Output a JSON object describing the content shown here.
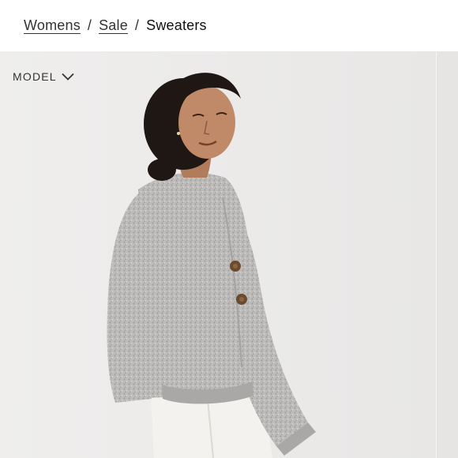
{
  "breadcrumb": {
    "items": [
      {
        "label": "Womens",
        "link": true
      },
      {
        "label": "Sale",
        "link": true
      },
      {
        "label": "Sweaters",
        "link": false
      }
    ],
    "separator": "/"
  },
  "gallery": {
    "model_toggle_label": "MODEL",
    "model_toggle_icon": "chevron-down-icon",
    "photo_subject": "model wearing grey button cardigan sweater"
  },
  "colors": {
    "background": "#ecebeb",
    "sweater": "#b9b8b6",
    "buttons": "#6b4a2e"
  }
}
